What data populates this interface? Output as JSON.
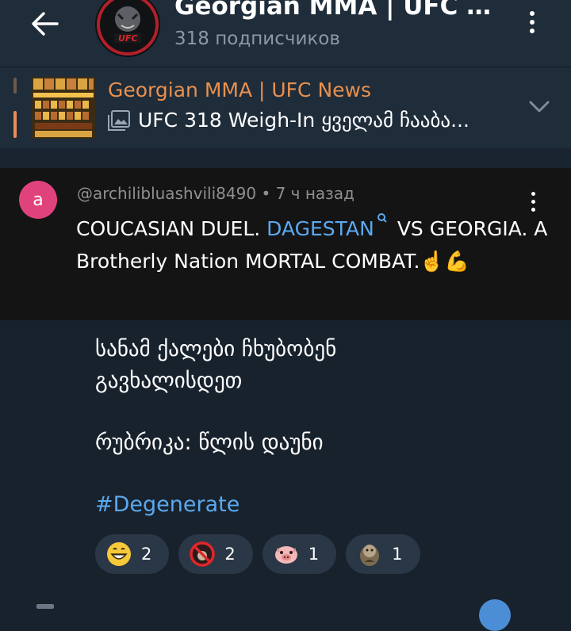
{
  "header": {
    "title": "Georgian MMA | UFC N...",
    "subtitle": "318 подписчиков",
    "avatar_text": "UFC"
  },
  "pinned": {
    "title": "Georgian MMA | UFC News",
    "text": "UFC 318 Weigh-In ყველამ ჩააბა..."
  },
  "comment": {
    "avatar_letter": "a",
    "author": "@archilibluashvili8490",
    "time": "7 ч назад",
    "text_part1": "COUCASIAN DUEL.",
    "link": "DAGESTAN",
    "text_part2": "VS GEORGIA. A  Brotherly Nation MORTAL COMBAT.☝️💪"
  },
  "post": {
    "line1": "სანამ ქალები ჩხუბობენ",
    "line2": "გავხალისდეთ",
    "line3": "რუბრიკა: წლის დაუნი",
    "hashtag": "#Degenerate"
  },
  "reactions": [
    {
      "icon": "grinning-face-icon",
      "count": "2"
    },
    {
      "icon": "no-sign-icon",
      "count": "2"
    },
    {
      "icon": "pig-face-icon",
      "count": "1"
    },
    {
      "icon": "sticker-icon",
      "count": "1"
    }
  ],
  "colors": {
    "background": "#18222d",
    "header": "#1f2c3a",
    "accent_orange": "#e8904f",
    "link_blue": "#5aa9f0",
    "comment_bg": "#141414",
    "avatar_pink": "#e0427c"
  }
}
